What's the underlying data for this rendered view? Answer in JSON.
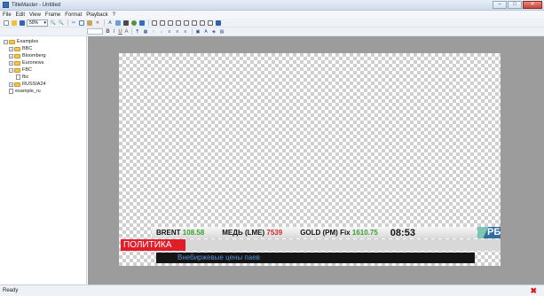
{
  "window": {
    "title": "TitleMaster - Untitled",
    "minimize": "–",
    "maximize": "□",
    "close": "✕"
  },
  "menu": [
    "File",
    "Edit",
    "View",
    "Frame",
    "Format",
    "Playback",
    "?"
  ],
  "toolbar": {
    "zoom_value": "50%"
  },
  "format_toolbar": {
    "bold": "B",
    "italic": "I",
    "underline": "U",
    "font": "A"
  },
  "tree": {
    "root": "Examples",
    "items": [
      {
        "label": "BBC"
      },
      {
        "label": "Bloomberg"
      },
      {
        "label": "Euronews"
      },
      {
        "label": "FBC"
      },
      {
        "label": "fbc"
      },
      {
        "label": "RUSSIA24"
      },
      {
        "label": "example_ru"
      }
    ]
  },
  "ticker": {
    "brent_label": "BRENT",
    "brent_value": "108.58",
    "copper_label": "МЕДЬ (LME)",
    "copper_value": "7539",
    "gold_label": "GOLD (PM) Fix",
    "gold_value": "1610.75",
    "time": "08:53",
    "logo": "РБК"
  },
  "category": "ПОЛИТИКА",
  "headline": "Внебиржевые цены паев",
  "status": "Ready",
  "colors": {
    "category_red": "#e21d2a",
    "up_green": "#3aa02e",
    "down_red": "#d22a2a",
    "headline_blue": "#5b8fd6"
  }
}
